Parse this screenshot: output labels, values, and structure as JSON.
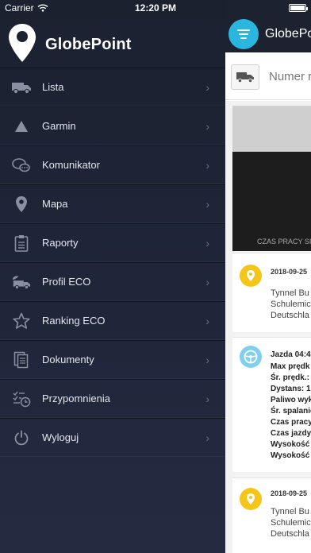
{
  "status": {
    "carrier": "Carrier",
    "time": "12:20 PM"
  },
  "app": {
    "title": "GlobePoint"
  },
  "menu": {
    "items": [
      {
        "label": "Lista",
        "icon": "truck-icon"
      },
      {
        "label": "Garmin",
        "icon": "triangle-icon"
      },
      {
        "label": "Komunikator",
        "icon": "chat-icon"
      },
      {
        "label": "Mapa",
        "icon": "map-pin-icon"
      },
      {
        "label": "Raporty",
        "icon": "clipboard-icon"
      },
      {
        "label": "Profil ECO",
        "icon": "eco-truck-icon"
      },
      {
        "label": "Ranking ECO",
        "icon": "star-icon"
      },
      {
        "label": "Dokumenty",
        "icon": "documents-icon"
      },
      {
        "label": "Przypomnienia",
        "icon": "reminder-icon"
      },
      {
        "label": "Wyloguj",
        "icon": "power-icon"
      }
    ],
    "chevron": "›"
  },
  "main": {
    "title": "GlobePo",
    "search_placeholder": "Numer r",
    "video_caption": "CZAS PRACY SIL",
    "cards": [
      {
        "date": "2018-09-25",
        "lines": [
          "Tynnel Bu",
          "Schulemic",
          "Deutschla"
        ]
      },
      {
        "title": "Jazda 04:4",
        "lines": [
          "Max prędk",
          "Śr. prędk.:",
          "Dystans: 1",
          "Paliwo wyk",
          "Śr. spalanie",
          "Czas pracy",
          "Czas jazdy",
          "Wysokość",
          "Wysokość"
        ]
      },
      {
        "date": "2018-09-25",
        "lines": [
          "Tynnel Bu",
          "Schulemic",
          "Deutschla"
        ]
      }
    ]
  },
  "colors": {
    "accent": "#2bb6e0",
    "pin": "#f5c518",
    "sidebar_bg": "#1d2230"
  }
}
